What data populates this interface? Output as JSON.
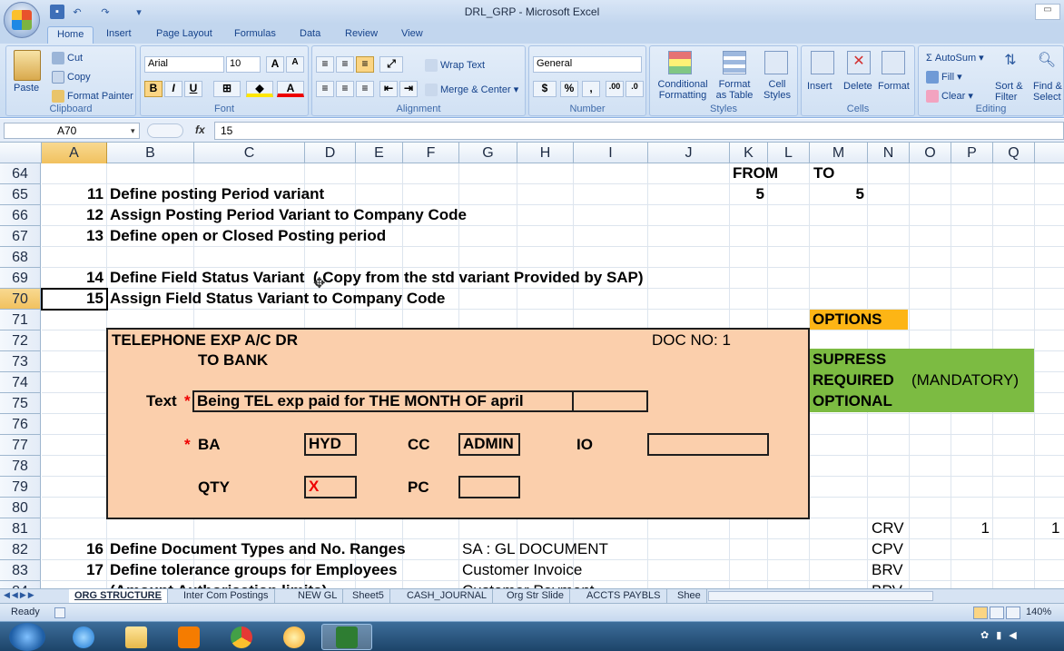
{
  "window": {
    "title": "DRL_GRP - Microsoft Excel"
  },
  "ribbon_tabs": [
    "Home",
    "Insert",
    "Page Layout",
    "Formulas",
    "Data",
    "Review",
    "View"
  ],
  "clipboard": {
    "paste": "Paste",
    "cut": "Cut",
    "copy": "Copy",
    "format_painter": "Format Painter",
    "label": "Clipboard"
  },
  "font": {
    "name": "Arial",
    "size": "10",
    "label": "Font",
    "bold": "B",
    "italic": "I",
    "underline": "U",
    "grow": "A",
    "shrink": "A"
  },
  "alignment": {
    "wrap": "Wrap Text",
    "merge": "Merge & Center",
    "label": "Alignment"
  },
  "number": {
    "format": "General",
    "currency": "$",
    "percent": "%",
    "comma": ",",
    "inc": ".00",
    "label": "Number"
  },
  "styles": {
    "conditional": "Conditional",
    "conditional2": "Formatting",
    "format_table": "Format",
    "format_table2": "as Table",
    "cell_styles": "Cell",
    "cell_styles2": "Styles",
    "label": "Styles"
  },
  "cells": {
    "insert": "Insert",
    "delete": "Delete",
    "format": "Format",
    "label": "Cells"
  },
  "editing": {
    "autosum": "AutoSum",
    "fill": "Fill",
    "clear": "Clear",
    "sort": "Sort &",
    "sort2": "Filter",
    "find": "Find &",
    "find2": "Select",
    "label": "Editing"
  },
  "formula_bar": {
    "name_box": "A70",
    "fx": "fx",
    "content": "15"
  },
  "columns": [
    "A",
    "B",
    "C",
    "D",
    "E",
    "F",
    "G",
    "H",
    "I",
    "J",
    "K",
    "L",
    "M",
    "N",
    "O",
    "P",
    "Q"
  ],
  "rows": [
    "64",
    "65",
    "66",
    "67",
    "68",
    "69",
    "70",
    "71",
    "72",
    "73",
    "74",
    "75",
    "76",
    "77",
    "78",
    "79",
    "80",
    "81",
    "82",
    "83",
    "84"
  ],
  "cells_data": {
    "k64": "FROM",
    "m64": "TO",
    "a65": "11",
    "b65": "Define posting Period variant",
    "k65": "5",
    "m65": "5",
    "a66": "12",
    "b66": "Assign Posting Period Variant to Company Code",
    "a67": "13",
    "b67": "Define open or Closed Posting period",
    "a69": "14",
    "b69": "Define Field Status Variant  ( Copy from the std variant Provided by SAP)",
    "a70": "15",
    "b70": "Assign Field Status Variant to Company Code",
    "m71": "OPTIONS",
    "m73": "SUPRESS",
    "m74": "REQUIRED",
    "o74": "(MANDATORY)",
    "m75": "OPTIONAL",
    "n81": "CRV",
    "p81": "1",
    "q81": "1",
    "a82": "16",
    "b82": "Define Document Types and No. Ranges",
    "g82": "SA : GL DOCUMENT",
    "n82": "CPV",
    "a83": "17",
    "b83": "Define tolerance groups for Employees",
    "g83": "Customer Invoice",
    "n83": "BRV",
    "b84": "(Amount Authorisation limits)",
    "g84": "Customer Payment",
    "n84": "BPV"
  },
  "sap_form": {
    "title1": "TELEPHONE EXP A/C DR",
    "title2": "TO BANK",
    "doc": "DOC NO: 1",
    "text_label": "Text",
    "star": "*",
    "text_value": "Being  TEL exp paid for THE MONTH OF april",
    "ba_label": "BA",
    "ba_value": "HYD",
    "cc_label": "CC",
    "cc_value": "ADMIN",
    "io_label": "IO",
    "qty_label": "QTY",
    "qty_value": "X",
    "pc_label": "PC"
  },
  "sheet_tabs": [
    "ORG STRUCTURE",
    "Inter Com Postings",
    "NEW GL",
    "Sheet5",
    "CASH_JOURNAL",
    "Org Str Slide",
    "ACCTS PAYBLS",
    "Shee"
  ],
  "status": {
    "ready": "Ready",
    "zoom": "140%"
  },
  "colors": {
    "options": "#fdb515",
    "green": "#7cbb42",
    "form": "#fbcfac",
    "selection": "#f1c15f"
  }
}
